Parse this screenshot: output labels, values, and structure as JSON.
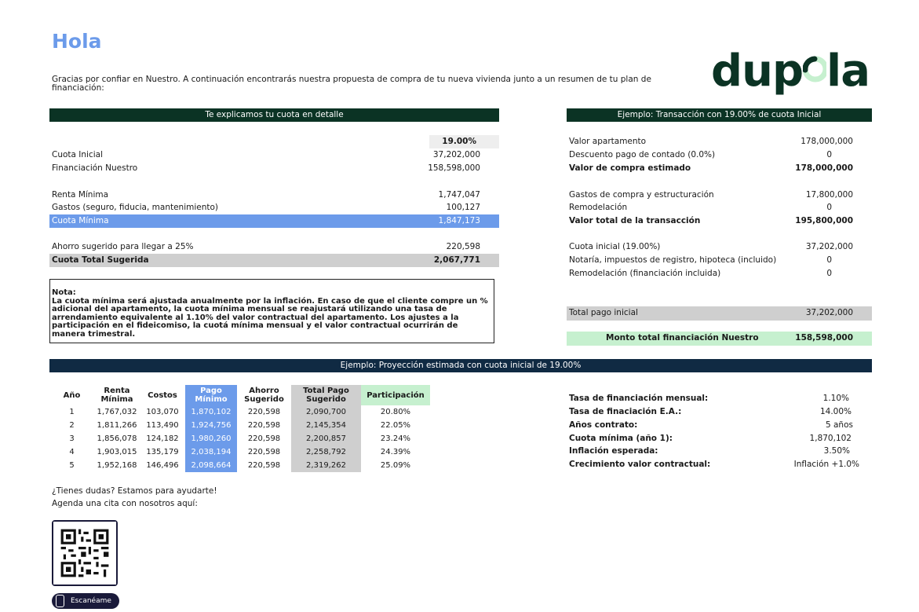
{
  "greeting": "Hola",
  "intro": "Gracias por confiar en Nuestro. A continuación encontrarás nuestra propuesta de compra de tu nueva vivienda junto a un resumen de tu plan de financiación:",
  "logo": {
    "left": "dup",
    "right": "la",
    "color": "#0b3324",
    "accent": "#c6f0cf"
  },
  "detail": {
    "header": "Te explicamos tu cuota en detalle",
    "percent": "19.00%",
    "rows": [
      {
        "label": "Cuota Inicial",
        "value": "37,202,000"
      },
      {
        "label": "Financiación Nuestro",
        "value": "158,598,000"
      },
      {
        "label": "Renta Mínima",
        "value": "1,747,047"
      },
      {
        "label": "Gastos (seguro, fiducia, mantenimiento)",
        "value": "100,127"
      },
      {
        "label": "Cuota Mínima",
        "value": "1,847,173"
      },
      {
        "label": "Ahorro sugerido para llegar a 25%",
        "value": "220,598"
      },
      {
        "label": "Cuota Total Sugerida",
        "value": "2,067,771"
      }
    ]
  },
  "note": {
    "title": "Nota:",
    "text": "La cuota mínima será ajustada anualmente por la inflación. En caso de que el cliente compre un % adicional del apartamento, la cuota mínima mensual se reajustará utilizando una tasa de arrendamiento equivalente al 1.10% del valor contractual del apartamento. Los ajustes a la participación en el fideicomiso, la cuotá mínima mensual y el valor contractual ocurrirán de manera trimestral."
  },
  "example": {
    "header": "Ejemplo: Transacción con 19.00% de cuota Inicial",
    "rows": [
      {
        "label": "Valor apartamento",
        "value": "178,000,000"
      },
      {
        "label": "Descuento pago de contado (0.0%)",
        "value": "0"
      },
      {
        "label": "Valor de compra estimado",
        "value": "178,000,000"
      },
      {
        "label": "Gastos de compra y estructuración",
        "value": "17,800,000"
      },
      {
        "label": "Remodelación",
        "value": "0"
      },
      {
        "label": "Valor total de la transacción",
        "value": "195,800,000"
      },
      {
        "label": "Cuota inicial (19.00%)",
        "value": "37,202,000"
      },
      {
        "label": "Notaría, impuestos de registro, hipoteca (incluido)",
        "value": "0"
      },
      {
        "label": "Remodelación (financiación incluida)",
        "value": "0"
      },
      {
        "label": "Total pago inicial",
        "value": "37,202,000"
      },
      {
        "label": "Monto total financiación Nuestro",
        "value": "158,598,000"
      }
    ]
  },
  "projection": {
    "header": "Ejemplo: Proyección estimada con cuota inicial de 19.00%",
    "columns": [
      "Año",
      "Renta Mínima",
      "Costos",
      "Pago Mínimo",
      "Ahorro Sugerido",
      "Total Pago Sugerido",
      "Participación"
    ],
    "rows": [
      [
        "1",
        "1,767,032",
        "103,070",
        "1,870,102",
        "220,598",
        "2,090,700",
        "20.80%"
      ],
      [
        "2",
        "1,811,266",
        "113,490",
        "1,924,756",
        "220,598",
        "2,145,354",
        "22.05%"
      ],
      [
        "3",
        "1,856,078",
        "124,182",
        "1,980,260",
        "220,598",
        "2,200,857",
        "23.24%"
      ],
      [
        "4",
        "1,903,015",
        "135,179",
        "2,038,194",
        "220,598",
        "2,258,792",
        "24.39%"
      ],
      [
        "5",
        "1,952,168",
        "146,496",
        "2,098,664",
        "220,598",
        "2,319,262",
        "25.09%"
      ]
    ]
  },
  "params": [
    {
      "label": "Tasa de financiación mensual:",
      "value": "1.10%"
    },
    {
      "label": "Tasa de finaciación E.A.:",
      "value": "14.00%"
    },
    {
      "label": "Años contrato:",
      "value": "5 años"
    },
    {
      "label": "Cuota mínima (año 1):",
      "value": "1,870,102"
    },
    {
      "label": "Inflación esperada:",
      "value": "3.50%"
    },
    {
      "label": "Crecimiento valor contractual:",
      "value": "Inflación +1.0%"
    }
  ],
  "contact": {
    "line1": "¿Tienes dudas? Estamos para ayudarte!",
    "line2": "Agenda una cita con nosotros aquí:",
    "scan_label": "Escanéame"
  }
}
